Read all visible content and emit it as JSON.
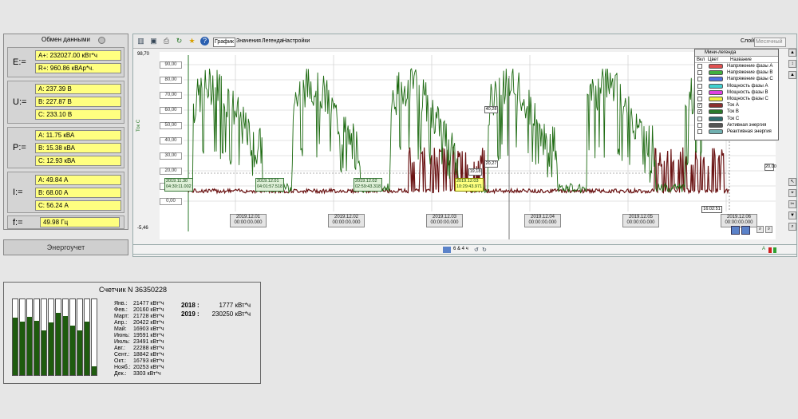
{
  "left_panel": {
    "header": "Обмен данными",
    "energy": {
      "label": "E:=",
      "a_plus": "A+:   232027.00 кВт*ч",
      "r_plus": "R+:   960.86 кВАр*ч."
    },
    "voltage": {
      "label": "U:=",
      "a": "A:   237.39 В",
      "b": "B:   227.87 В",
      "c": "C:   233.10 В"
    },
    "power": {
      "label": "P:=",
      "a": "A:   11.75 кВА",
      "b": "B:   15.38 кВА",
      "c": "C:   12.93 кВА"
    },
    "current": {
      "label": "I:=",
      "a": "A:   49.84 А",
      "b": "B:   68.00 А",
      "c": "C:   56.24 А"
    },
    "frequency": {
      "label": "f:=",
      "value": "49.98 Гц"
    },
    "energy_button": "Энергоучет"
  },
  "toolbar": {
    "tabs": [
      "График",
      "Значения",
      "Легенда",
      "Настройки"
    ],
    "right_label": "Слой",
    "right_field": "Месячный"
  },
  "chart_data": {
    "type": "line",
    "top_label": "98,70",
    "bottom_label": "-5,46",
    "y_axis_title": "Ток С",
    "y_ticks": [
      "90,00",
      "80,00",
      "70,00",
      "60,00",
      "50,00",
      "40,00",
      "30,00",
      "20,00",
      "10,00",
      "0,00"
    ],
    "x_labels": [
      {
        "date": "2019.12.01",
        "time": "00:00:00.000"
      },
      {
        "date": "2019.12.02",
        "time": "00:00:00.000"
      },
      {
        "date": "2019.12.03",
        "time": "00:00:00.000"
      },
      {
        "date": "2019.12.04",
        "time": "00:00:00.000"
      },
      {
        "date": "2019.12.05",
        "time": "00:00:00.000"
      },
      {
        "date": "2019.12.06",
        "time": "00:00:00.000"
      }
    ],
    "markers": [
      {
        "date": "2019.11.30",
        "time": "04:30:11.002",
        "highlight": false
      },
      {
        "date": "2019.12.01",
        "time": "04:01:57.518",
        "highlight": false
      },
      {
        "date": "2019.12.02",
        "time": "02:59:43.318",
        "highlight": false
      },
      {
        "date": "2019.12.03",
        "time": "10:29:43.971",
        "highlight": true
      }
    ],
    "value_tags": [
      "40,28",
      "20,27",
      "19,18",
      "20,00"
    ],
    "end_label": "16:02:51",
    "series": [
      {
        "name": "Ток А",
        "color": "#1e6b12"
      },
      {
        "name": "Ток С",
        "color": "#6b1414"
      }
    ]
  },
  "legend": {
    "title": "Мини-легенда",
    "columns": [
      "Вкл",
      "Цвет",
      "Название"
    ],
    "items": [
      {
        "name": "Напряжение фазы А",
        "color": "#e05050",
        "checked": false
      },
      {
        "name": "Напряжение фазы В",
        "color": "#40b040",
        "checked": false
      },
      {
        "name": "Напряжение фазы С",
        "color": "#5070e0",
        "checked": false
      },
      {
        "name": "Мощность фазы А",
        "color": "#40d0d0",
        "checked": false
      },
      {
        "name": "Мощность фазы В",
        "color": "#e040e0",
        "checked": false
      },
      {
        "name": "Мощность фазы С",
        "color": "#f0f040",
        "checked": false
      },
      {
        "name": "Ток А",
        "color": "#8a3030",
        "checked": true
      },
      {
        "name": "Ток В",
        "color": "#2a7a2a",
        "checked": true
      },
      {
        "name": "Ток С",
        "color": "#2e6e6e",
        "checked": false
      },
      {
        "name": "Активная энергия",
        "color": "#555555",
        "checked": false
      },
      {
        "name": "Реактивная энергия",
        "color": "#70b0b0",
        "checked": false
      }
    ]
  },
  "bottom_strip": {
    "label": "6 & 4 ч"
  },
  "counter": {
    "title": "Счетчик N 36350228",
    "months": [
      {
        "name": "Янв.:",
        "value": "21477 кВт*ч",
        "level": 0.92
      },
      {
        "name": "Фев.:",
        "value": "20160 кВт*ч",
        "level": 0.86
      },
      {
        "name": "Март:",
        "value": "21728 кВт*ч",
        "level": 0.93
      },
      {
        "name": "Апр.:",
        "value": "20422 кВт*ч",
        "level": 0.87
      },
      {
        "name": "Май:",
        "value": "16903 кВт*ч",
        "level": 0.72
      },
      {
        "name": "Июнь:",
        "value": "19591 кВт*ч",
        "level": 0.84
      },
      {
        "name": "Июль:",
        "value": "23491 кВт*ч",
        "level": 1.0
      },
      {
        "name": "Авг.:",
        "value": "22288 кВт*ч",
        "level": 0.95
      },
      {
        "name": "Сент.:",
        "value": "18842 кВт*ч",
        "level": 0.8
      },
      {
        "name": "Окт.:",
        "value": "16793 кВт*ч",
        "level": 0.72
      },
      {
        "name": "Нояб.:",
        "value": "20253 кВт*ч",
        "level": 0.86
      },
      {
        "name": "Дек.:",
        "value": "3303 кВт*ч",
        "level": 0.14
      }
    ],
    "years": [
      {
        "year": "2018 :",
        "value": "1777 кВт*ч"
      },
      {
        "year": "2019 :",
        "value": "230250 кВт*ч"
      }
    ]
  }
}
